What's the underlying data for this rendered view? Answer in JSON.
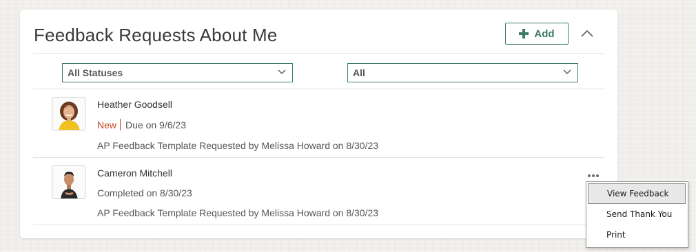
{
  "card": {
    "title": "Feedback Requests About Me",
    "add_label": "Add"
  },
  "filters": {
    "status": {
      "selected": "All Statuses"
    },
    "type": {
      "selected": "All"
    }
  },
  "requests": [
    {
      "name": "Heather Goodsell",
      "status": "New",
      "due": "Due on 9/6/23",
      "detail": "AP Feedback Template Requested by Melissa Howard on 8/30/23"
    },
    {
      "name": "Cameron Mitchell",
      "status": "Completed on 8/30/23",
      "detail": "AP Feedback Template Requested by Melissa Howard on 8/30/23"
    }
  ],
  "context_menu": {
    "items": [
      "View Feedback",
      "Send Thank You",
      "Print"
    ]
  },
  "colors": {
    "accent": "#3c7a63",
    "status_new": "#c0461e"
  },
  "icons": {
    "add": "plus-icon",
    "collapse": "chevron-up-icon",
    "dropdown": "chevron-down-icon",
    "more": "ellipsis-icon"
  }
}
